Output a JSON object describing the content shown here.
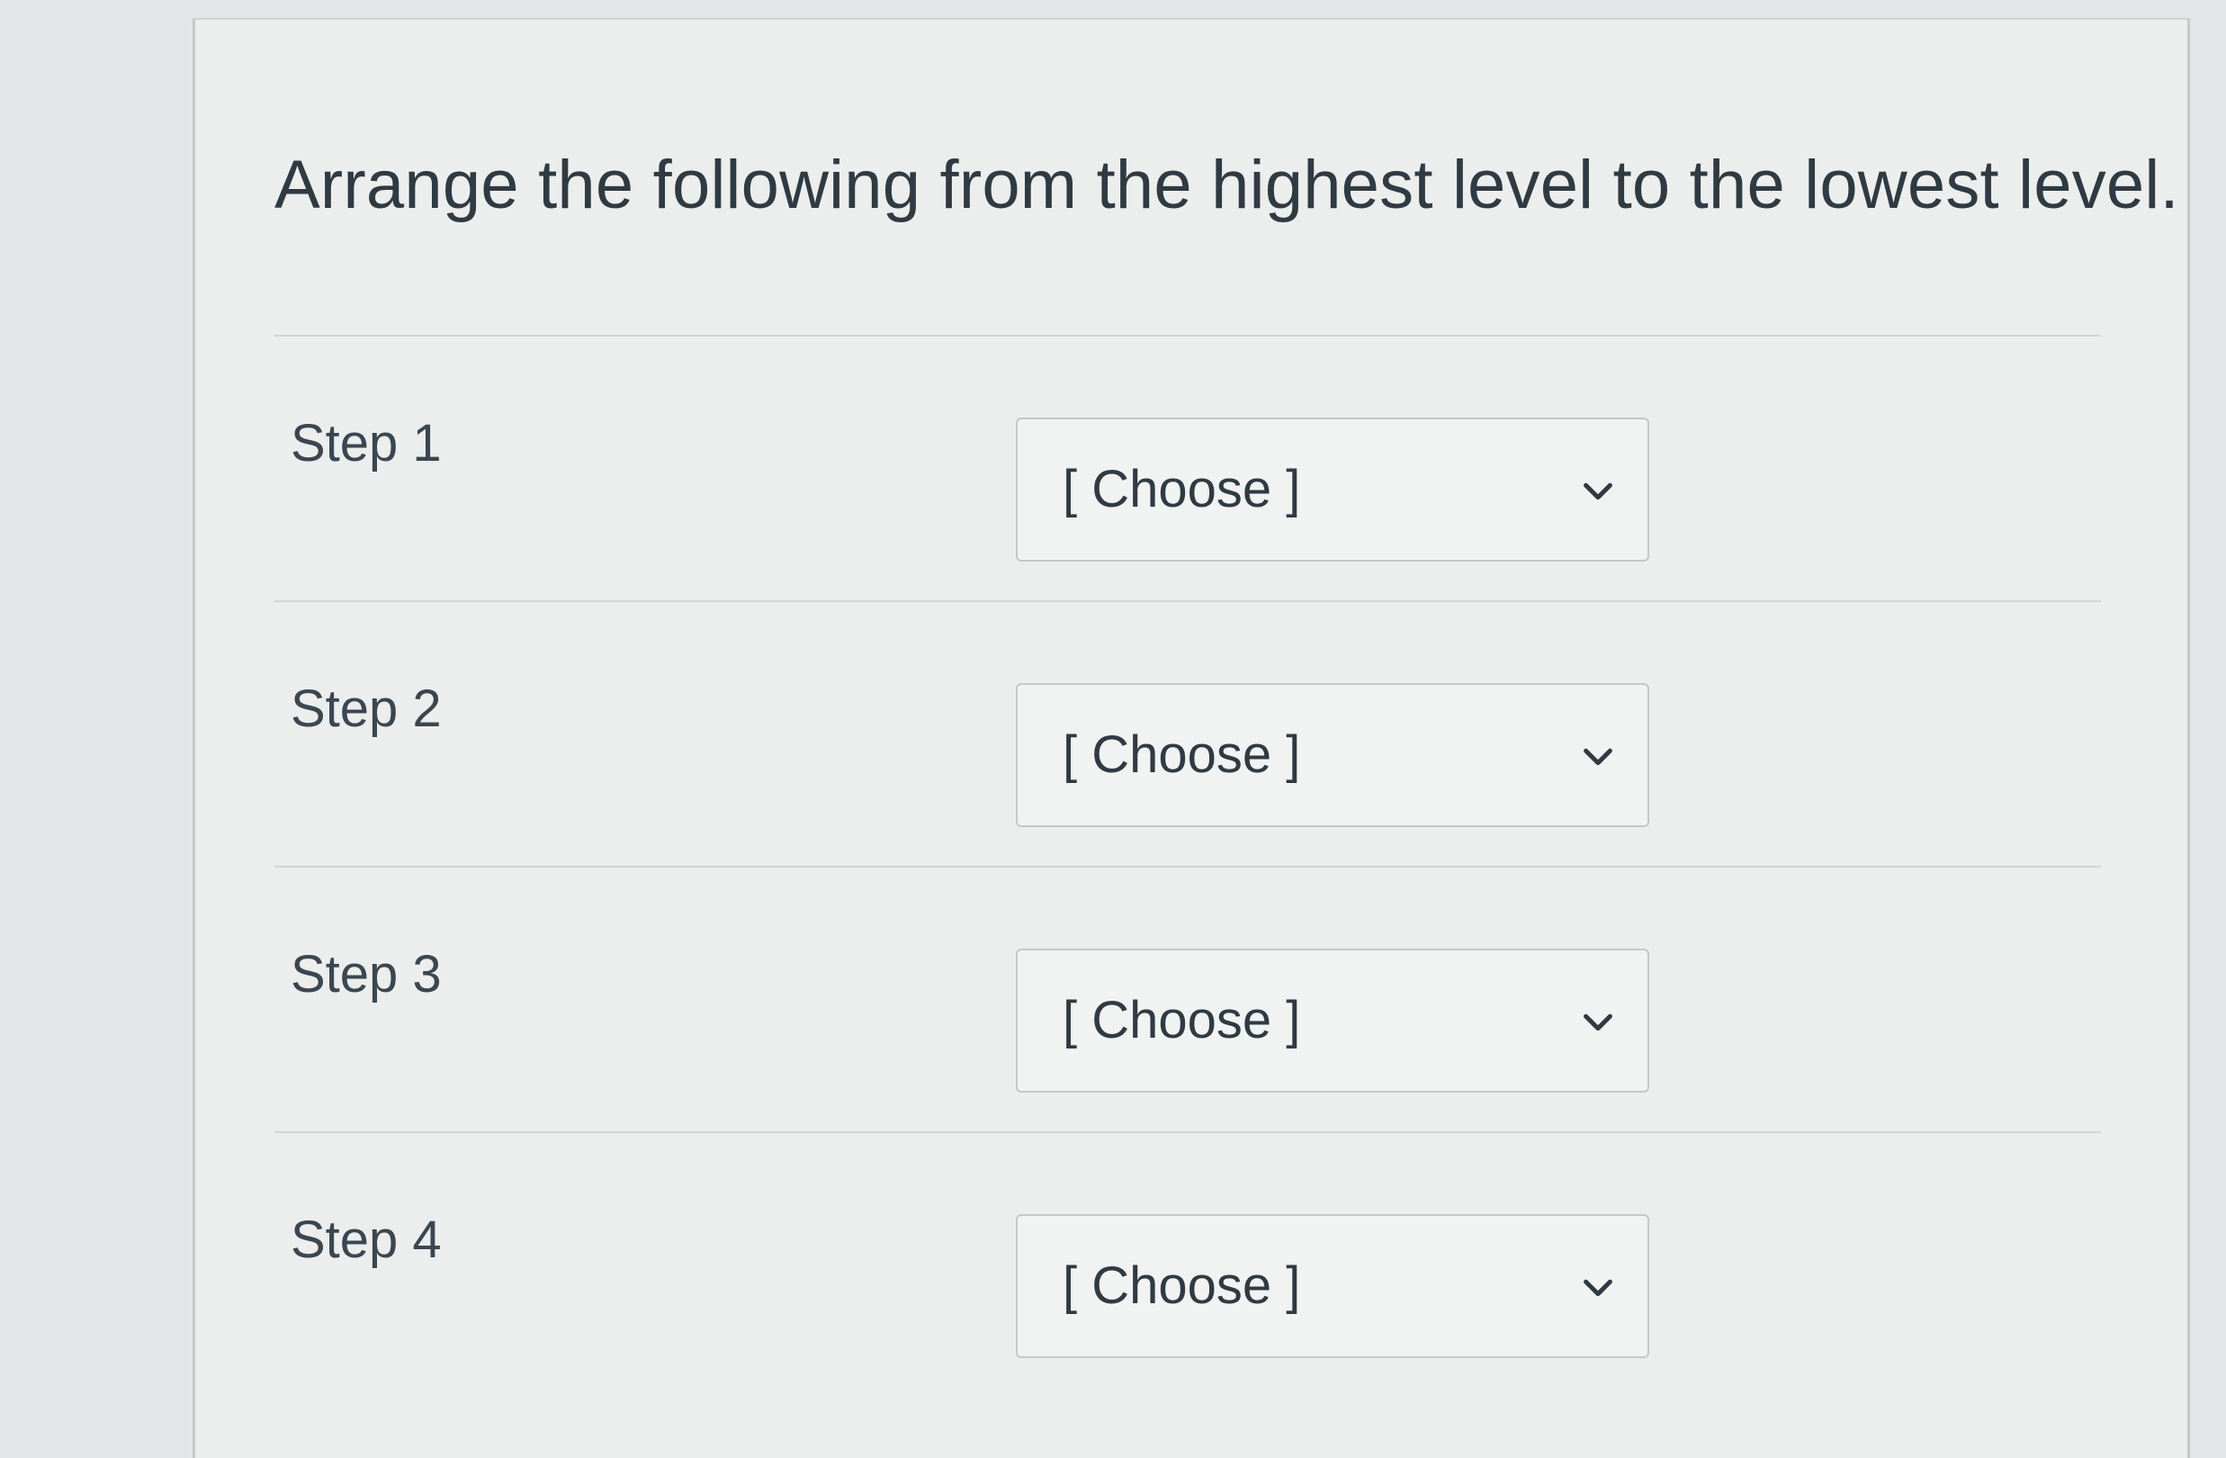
{
  "question": {
    "text": "Arrange the following from the highest level to the lowest level."
  },
  "steps": [
    {
      "label": "Step 1",
      "selected": "[ Choose ]"
    },
    {
      "label": "Step 2",
      "selected": "[ Choose ]"
    },
    {
      "label": "Step 3",
      "selected": "[ Choose ]"
    },
    {
      "label": "Step 4",
      "selected": "[ Choose ]"
    }
  ],
  "icons": {
    "dropdown": "chevron-down-icon"
  }
}
